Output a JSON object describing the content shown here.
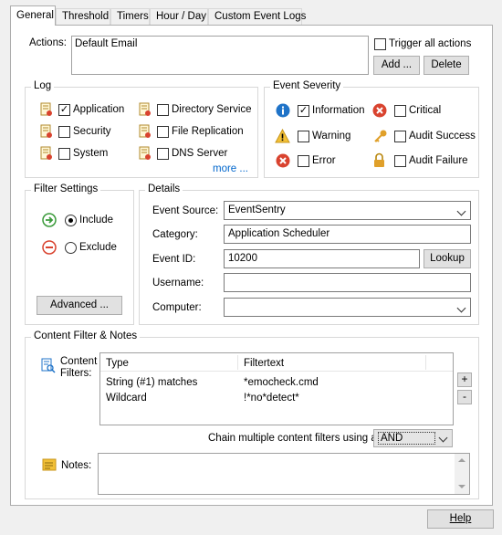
{
  "tabs": [
    "General",
    "Threshold",
    "Timers",
    "Hour / Day",
    "Custom Event Logs"
  ],
  "actions": {
    "label": "Actions:",
    "list": [
      "Default Email"
    ],
    "trigger_all_label": "Trigger all actions",
    "trigger_all_checked": false,
    "add_label": "Add ...",
    "delete_label": "Delete"
  },
  "log": {
    "title": "Log",
    "items": [
      {
        "label": "Application",
        "checked": true
      },
      {
        "label": "Directory Service",
        "checked": false
      },
      {
        "label": "Security",
        "checked": false
      },
      {
        "label": "File Replication",
        "checked": false
      },
      {
        "label": "System",
        "checked": false
      },
      {
        "label": "DNS Server",
        "checked": false
      }
    ],
    "more_label": "more ..."
  },
  "severity": {
    "title": "Event Severity",
    "items": [
      {
        "label": "Information",
        "checked": true,
        "icon": "info-icon"
      },
      {
        "label": "Critical",
        "checked": false,
        "icon": "critical-icon"
      },
      {
        "label": "Warning",
        "checked": false,
        "icon": "warning-icon"
      },
      {
        "label": "Audit Success",
        "checked": false,
        "icon": "key-icon"
      },
      {
        "label": "Error",
        "checked": false,
        "icon": "error-icon"
      },
      {
        "label": "Audit Failure",
        "checked": false,
        "icon": "lock-icon"
      }
    ]
  },
  "filter_settings": {
    "title": "Filter Settings",
    "include_label": "Include",
    "exclude_label": "Exclude",
    "selected": "Include",
    "advanced_label": "Advanced ..."
  },
  "details": {
    "title": "Details",
    "event_source_label": "Event Source:",
    "event_source_value": "EventSentry",
    "category_label": "Category:",
    "category_value": "Application Scheduler",
    "event_id_label": "Event ID:",
    "event_id_value": "10200",
    "lookup_label": "Lookup",
    "username_label": "Username:",
    "username_value": "",
    "computer_label": "Computer:",
    "computer_value": ""
  },
  "content_filter": {
    "title": "Content Filter & Notes",
    "filters_label_1": "Content",
    "filters_label_2": "Filters:",
    "columns": [
      "Type",
      "Filtertext"
    ],
    "rows": [
      [
        "String (#1) matches",
        "*emocheck.cmd"
      ],
      [
        "Wildcard",
        "!*no*detect*"
      ]
    ],
    "plus_label": "+",
    "minus_label": "-",
    "chain_label": "Chain multiple content filters using a",
    "chain_value": "AND",
    "notes_label": "Notes:",
    "notes_value": ""
  },
  "help_label": "Help",
  "colors": {
    "accent_green": "#3a9a3a",
    "error_red": "#d9432f",
    "info_blue": "#1f73c8",
    "link": "#0066cc"
  }
}
